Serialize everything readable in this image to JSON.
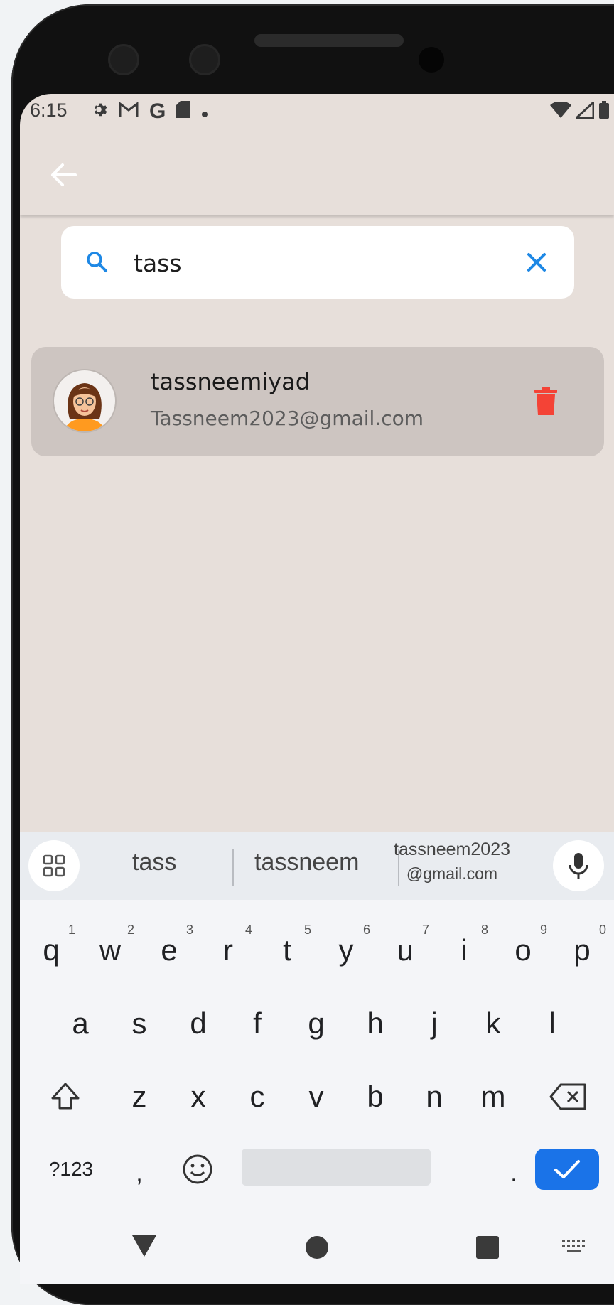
{
  "status_bar": {
    "time": "6:15",
    "icons": [
      "settings-icon",
      "gmail-icon",
      "google-icon",
      "sd-card-icon",
      "dot-icon"
    ],
    "right_icons": [
      "wifi-icon",
      "signal-icon",
      "battery-icon"
    ]
  },
  "app_bar": {
    "back_icon": "arrow-left-icon"
  },
  "search": {
    "value": "tass",
    "placeholder": "",
    "accent_color": "#1e88e5"
  },
  "results": [
    {
      "username": "tassneemiyad",
      "email": "Tassneem2023@gmail.com",
      "delete_color": "#f44336"
    }
  ],
  "keyboard": {
    "suggestions": [
      "tass",
      "tassneem"
    ],
    "suggestion_email_line1": "tassneem2023",
    "suggestion_email_line2": "@gmail.com",
    "row1": [
      {
        "k": "q",
        "n": "1"
      },
      {
        "k": "w",
        "n": "2"
      },
      {
        "k": "e",
        "n": "3"
      },
      {
        "k": "r",
        "n": "4"
      },
      {
        "k": "t",
        "n": "5"
      },
      {
        "k": "y",
        "n": "6"
      },
      {
        "k": "u",
        "n": "7"
      },
      {
        "k": "i",
        "n": "8"
      },
      {
        "k": "o",
        "n": "9"
      },
      {
        "k": "p",
        "n": "0"
      }
    ],
    "row2": [
      "a",
      "s",
      "d",
      "f",
      "g",
      "h",
      "j",
      "k",
      "l"
    ],
    "row3": [
      "z",
      "x",
      "c",
      "v",
      "b",
      "n",
      "m"
    ],
    "symbols_label": "?123",
    "comma": ",",
    "period": "."
  }
}
